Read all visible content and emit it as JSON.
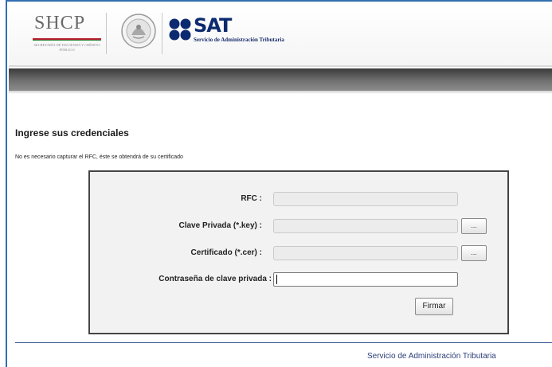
{
  "header": {
    "shcp_title": "SHCP",
    "shcp_subtitle": "SECRETARÍA DE HACIENDA Y CRÉDITO PÚBLICO",
    "sat_title": "SAT",
    "sat_subtitle": "Servicio de Administración Tributaria"
  },
  "page": {
    "heading": "Ingrese sus credenciales",
    "note": "No es necesario capturar el RFC, éste se obtendrá de su certificado"
  },
  "form": {
    "rfc_label": "RFC :",
    "rfc_value": "",
    "key_label": "Clave Privada (*.key) :",
    "key_value": "",
    "key_browse": "...",
    "cer_label": "Certificado (*.cer) :",
    "cer_value": "",
    "cer_browse": "...",
    "password_label": "Contraseña de clave privada :",
    "password_value": "",
    "submit_label": "Firmar"
  },
  "footer": {
    "text": "Servicio de Administración Tributaria"
  },
  "colors": {
    "frame_border": "#2f6fb0",
    "sat_blue": "#0b2a6f",
    "footer_text": "#2b3f7a"
  }
}
